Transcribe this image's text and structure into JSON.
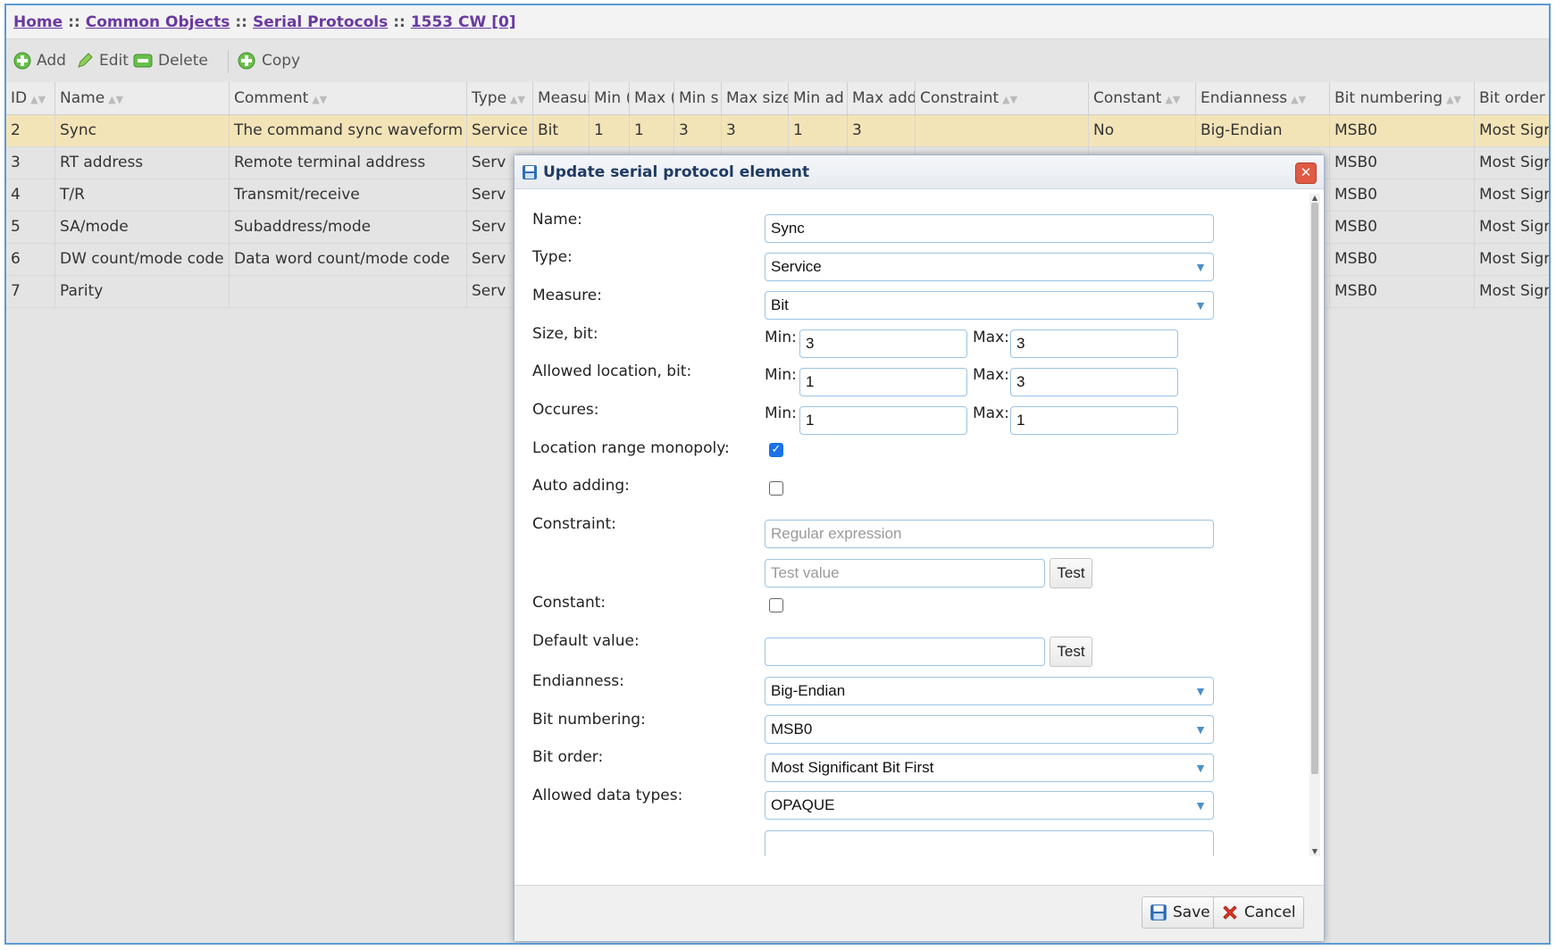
{
  "breadcrumb": {
    "items": [
      "Home",
      "Common Objects",
      "Serial Protocols",
      "1553 CW [0]"
    ],
    "separator": "::"
  },
  "toolbar": {
    "add": "Add",
    "edit": "Edit",
    "delete": "Delete",
    "copy": "Copy"
  },
  "grid": {
    "columns": [
      "ID",
      "Name",
      "Comment",
      "Type",
      "Measui",
      "Min (",
      "Max (",
      "Min s",
      "Max size",
      "Min ad",
      "Max add",
      "Constraint",
      "Constant",
      "Endianness",
      "Bit numbering",
      "Bit order"
    ],
    "rows": [
      [
        "2",
        "Sync",
        "The command sync waveform",
        "Service",
        "Bit",
        "1",
        "1",
        "3",
        "3",
        "1",
        "3",
        "",
        "No",
        "Big-Endian",
        "MSB0",
        "Most Sigr"
      ],
      [
        "3",
        "RT address",
        "Remote terminal address",
        "Serv",
        "",
        "",
        "",
        "",
        "",
        "",
        "",
        "",
        "",
        "",
        "MSB0",
        "Most Sigr"
      ],
      [
        "4",
        "T/R",
        "Transmit/receive",
        "Serv",
        "",
        "",
        "",
        "",
        "",
        "",
        "",
        "",
        "",
        "",
        "MSB0",
        "Most Sigr"
      ],
      [
        "5",
        "SA/mode",
        "Subaddress/mode",
        "Serv",
        "",
        "",
        "",
        "",
        "",
        "",
        "",
        "",
        "",
        "",
        "MSB0",
        "Most Sigr"
      ],
      [
        "6",
        "DW count/mode code",
        "Data word count/mode code",
        "Serv",
        "",
        "",
        "",
        "",
        "",
        "",
        "",
        "",
        "",
        "",
        "MSB0",
        "Most Sigr"
      ],
      [
        "7",
        "Parity",
        "",
        "Serv",
        "",
        "",
        "",
        "",
        "",
        "",
        "",
        "",
        "",
        "",
        "MSB0",
        "Most Sigr"
      ]
    ]
  },
  "dialog": {
    "title": "Update serial protocol element",
    "labels": {
      "name": "Name:",
      "type": "Type:",
      "measure": "Measure:",
      "size": "Size, bit:",
      "location": "Allowed location, bit:",
      "occures": "Occures:",
      "monopoly": "Location range monopoly:",
      "auto": "Auto adding:",
      "constraint": "Constraint:",
      "constant": "Constant:",
      "default": "Default value:",
      "endianness": "Endianness:",
      "bitnum": "Bit numbering:",
      "bitorder": "Bit order:",
      "datatypes": "Allowed data types:",
      "min": "Min:",
      "max": "Max:"
    },
    "values": {
      "name": "Sync",
      "type": "Service",
      "measure": "Bit",
      "size_min": "3",
      "size_max": "3",
      "loc_min": "1",
      "loc_max": "3",
      "occ_min": "1",
      "occ_max": "1",
      "constraint": "",
      "test_value": "",
      "default_value": "",
      "endianness": "Big-Endian",
      "bitnum": "MSB0",
      "bitorder": "Most Significant Bit First",
      "datatypes": "OPAQUE"
    },
    "placeholders": {
      "constraint": "Regular expression",
      "test_value": "Test value"
    },
    "checks": {
      "monopoly": true,
      "auto": false,
      "constant": false
    },
    "test_label": "Test",
    "save": "Save",
    "cancel": "Cancel"
  },
  "colors": {
    "selected_row": "#f3e4b8",
    "link": "#6a3aa0",
    "input_border": "#9cc4e4",
    "checkbox_on": "#1a73e8"
  }
}
